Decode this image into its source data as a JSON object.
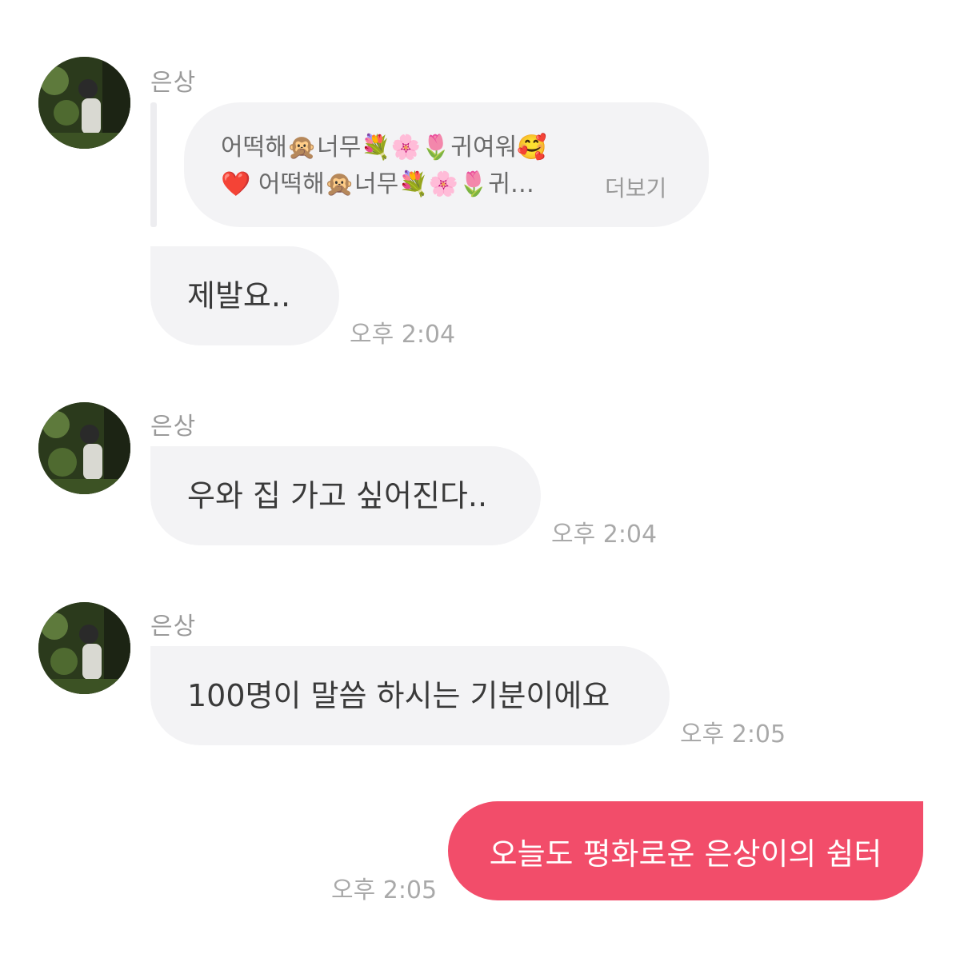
{
  "messages": [
    {
      "sender": "은상",
      "quote_line1": "어떡해🙊너무💐🌸🌷귀여워🥰",
      "quote_line2": "❤️ 어떡해🙊너무💐🌸🌷귀…",
      "more_label": "더보기",
      "text": "제발요..",
      "time": "오후 2:04"
    },
    {
      "sender": "은상",
      "text": "우와 집 가고 싶어진다..",
      "time": "오후 2:04"
    },
    {
      "sender": "은상",
      "text": "100명이 말씀 하시는 기분이에요",
      "time": "오후 2:05"
    }
  ],
  "sent": {
    "text": "오늘도 평화로운 은상이의 쉼터",
    "time": "오후 2:05"
  },
  "colors": {
    "received_bubble": "#f3f3f5",
    "sent_bubble": "#f24d6a",
    "timestamp": "#a9a9a9",
    "sender_name": "#9a9a9a"
  },
  "icons": {
    "avatar": "profile-photo-avatar"
  }
}
